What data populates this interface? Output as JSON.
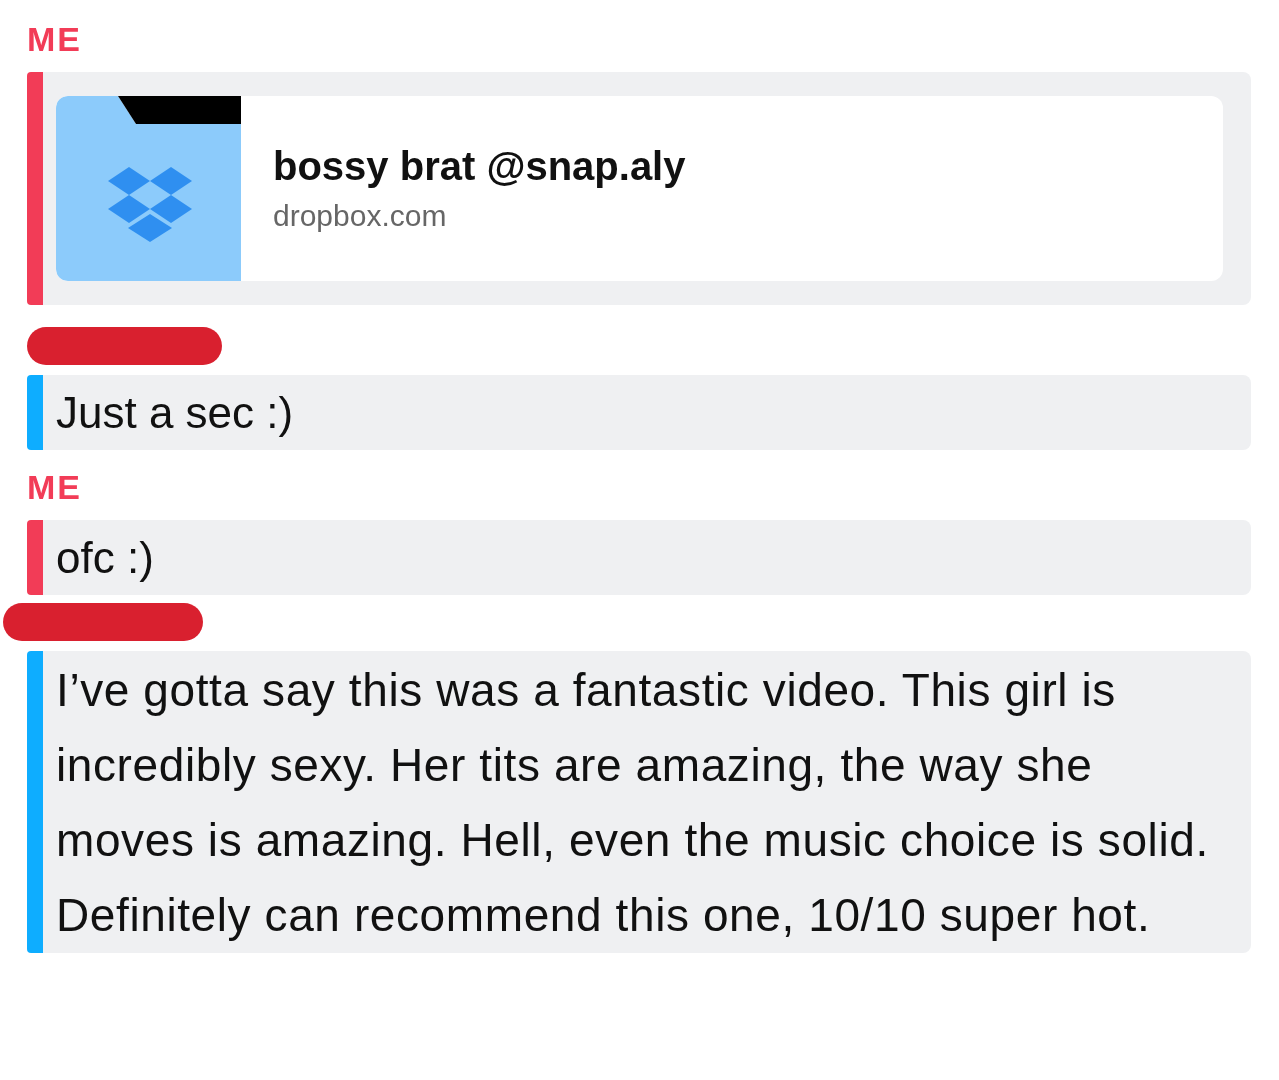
{
  "messages": [
    {
      "color": "#f23c57",
      "label": "ME",
      "redacted": false,
      "kind": "link",
      "title": "bossy brat @snap.aly",
      "url": "dropbox.com"
    },
    {
      "color": "#0eadff",
      "redacted": true,
      "kind": "text",
      "text": "Just a sec :)"
    },
    {
      "color": "#f23c57",
      "label": "ME",
      "redacted": false,
      "kind": "text",
      "text": "ofc :)"
    },
    {
      "color": "#0eadff",
      "redacted": true,
      "kind": "text",
      "text": "I’ve gotta say this was a fantastic video. This girl is incredibly sexy. Her tits are amazing, the way she moves is amazing. Hell, even the music choice is solid. Definitely can recommend this one, 10/10 super hot."
    }
  ]
}
